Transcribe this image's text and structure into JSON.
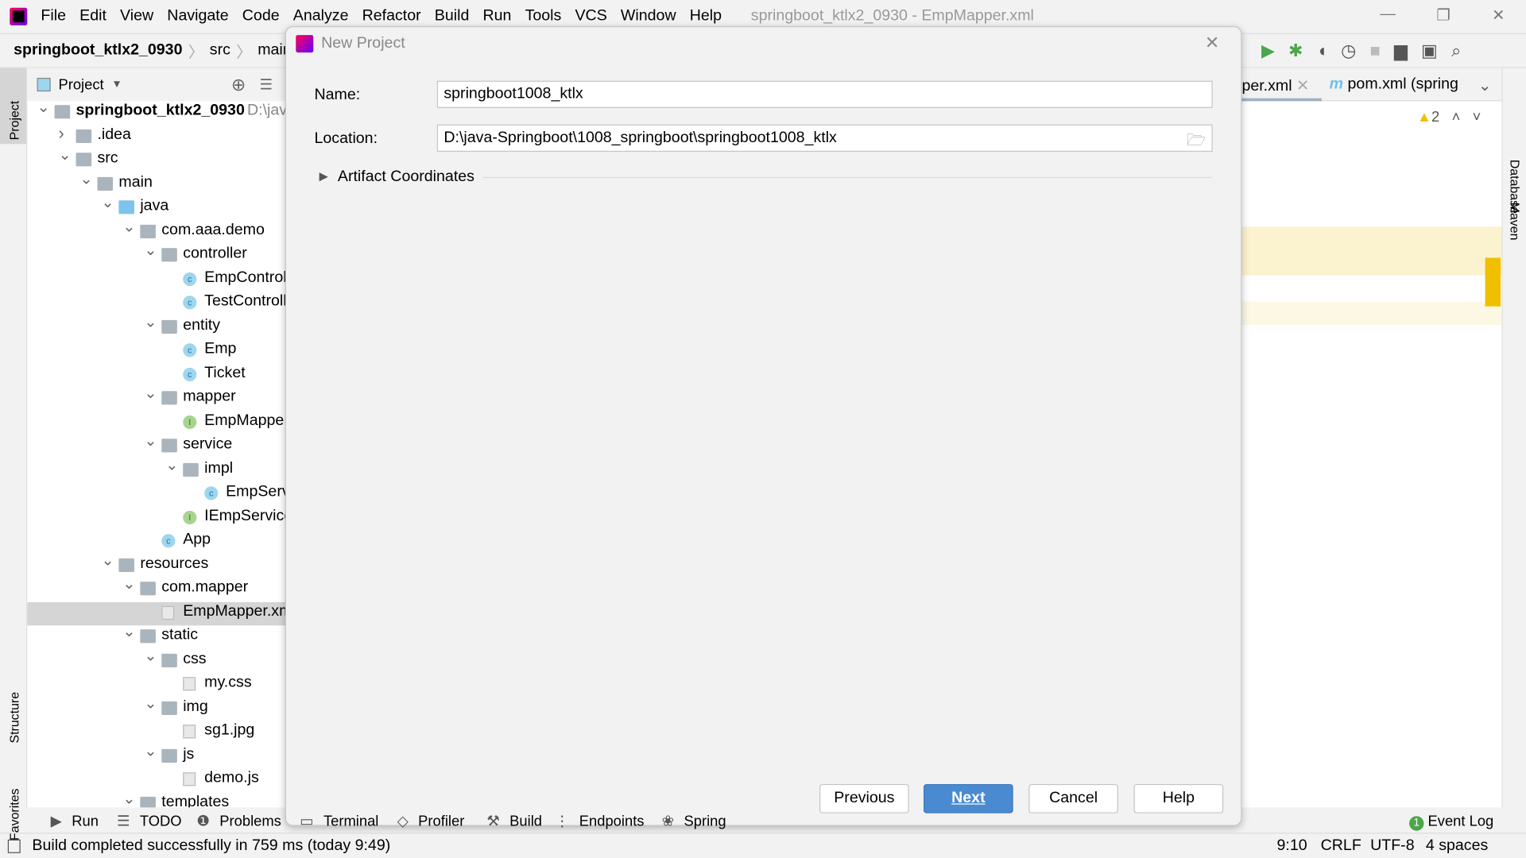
{
  "window": {
    "title": "springboot_ktlx2_0930 - EmpMapper.xml",
    "menu": [
      "File",
      "Edit",
      "View",
      "Navigate",
      "Code",
      "Analyze",
      "Refactor",
      "Build",
      "Run",
      "Tools",
      "VCS",
      "Window",
      "Help"
    ]
  },
  "breadcrumb": [
    "springboot_ktlx2_0930",
    "src",
    "main"
  ],
  "left_strip": {
    "project": "Project",
    "structure": "Structure",
    "favorites": "Favorites"
  },
  "right_strip": {
    "database": "Database",
    "maven": "Maven"
  },
  "project_panel": {
    "title": "Project",
    "tree": [
      {
        "label": "springboot_ktlx2_0930",
        "hint": "D:\\jav",
        "level": 0,
        "type": "module",
        "expanded": true
      },
      {
        "label": ".idea",
        "level": 1,
        "type": "folder",
        "expanded": false
      },
      {
        "label": "src",
        "level": 1,
        "type": "folder",
        "expanded": true
      },
      {
        "label": "main",
        "level": 2,
        "type": "folder",
        "expanded": true
      },
      {
        "label": "java",
        "level": 3,
        "type": "source-folder",
        "expanded": true
      },
      {
        "label": "com.aaa.demo",
        "level": 4,
        "type": "package",
        "expanded": true
      },
      {
        "label": "controller",
        "level": 5,
        "type": "package",
        "expanded": true
      },
      {
        "label": "EmpControl",
        "level": 6,
        "type": "class"
      },
      {
        "label": "TestControll",
        "level": 6,
        "type": "class"
      },
      {
        "label": "entity",
        "level": 5,
        "type": "package",
        "expanded": true
      },
      {
        "label": "Emp",
        "level": 6,
        "type": "class"
      },
      {
        "label": "Ticket",
        "level": 6,
        "type": "class"
      },
      {
        "label": "mapper",
        "level": 5,
        "type": "package",
        "expanded": true
      },
      {
        "label": "EmpMappe",
        "level": 6,
        "type": "interface"
      },
      {
        "label": "service",
        "level": 5,
        "type": "package",
        "expanded": true
      },
      {
        "label": "impl",
        "level": 6,
        "type": "package",
        "expanded": true
      },
      {
        "label": "EmpServ",
        "level": 7,
        "type": "class"
      },
      {
        "label": "IEmpService",
        "level": 6,
        "type": "interface"
      },
      {
        "label": "App",
        "level": 5,
        "type": "class"
      },
      {
        "label": "resources",
        "level": 3,
        "type": "folder",
        "expanded": true
      },
      {
        "label": "com.mapper",
        "level": 4,
        "type": "folder",
        "expanded": true
      },
      {
        "label": "EmpMapper.xm",
        "level": 5,
        "type": "file",
        "selected": true
      },
      {
        "label": "static",
        "level": 4,
        "type": "folder",
        "expanded": true
      },
      {
        "label": "css",
        "level": 5,
        "type": "folder",
        "expanded": true
      },
      {
        "label": "my.css",
        "level": 6,
        "type": "file"
      },
      {
        "label": "img",
        "level": 5,
        "type": "folder",
        "expanded": true
      },
      {
        "label": "sg1.jpg",
        "level": 6,
        "type": "file"
      },
      {
        "label": "js",
        "level": 5,
        "type": "folder",
        "expanded": true
      },
      {
        "label": "demo.js",
        "level": 6,
        "type": "file"
      },
      {
        "label": "templates",
        "level": 4,
        "type": "folder",
        "expanded": true
      }
    ]
  },
  "editor": {
    "tabs": [
      "per.xml",
      "pom.xml (spring"
    ],
    "warnings": "2"
  },
  "dialog": {
    "title": "New Project",
    "name_label": "Name:",
    "name_value": "springboot1008_ktlx",
    "location_label": "Location:",
    "location_value": "D:\\java-Springboot\\1008_springboot\\springboot1008_ktlx",
    "artifact": "Artifact Coordinates",
    "buttons": {
      "previous": "Previous",
      "next": "Next",
      "cancel": "Cancel",
      "help": "Help"
    }
  },
  "bottom_tools": [
    "Run",
    "TODO",
    "Problems",
    "Terminal",
    "Profiler",
    "Build",
    "Endpoints",
    "Spring"
  ],
  "event_log": {
    "count": "1",
    "label": "Event Log"
  },
  "status": {
    "message": "Build completed successfully in 759 ms (today 9:49)",
    "position": "9:10",
    "line_sep": "CRLF",
    "encoding": "UTF-8",
    "indent": "4 spaces"
  },
  "colors": {
    "accent": "#4a8ad1",
    "run": "#4ca64c",
    "warning": "#f0c000"
  }
}
